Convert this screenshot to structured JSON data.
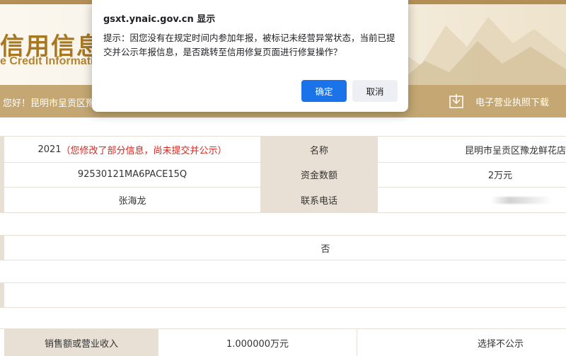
{
  "header": {
    "title_cn": "信用信息公",
    "title_en": "e Credit Informatio"
  },
  "nav": {
    "greeting": "您好！昆明市呈贡区豫",
    "download_label": "电子营业执照下载"
  },
  "table": {
    "row1": {
      "year": "2021",
      "note": "（您修改了部分信息，尚未提交并公示）",
      "label": "名称",
      "value": "昆明市呈贡区豫龙鲜花店"
    },
    "row2": {
      "value_left": "92530121MA6PACE15Q",
      "label": "资金数额",
      "value": "2万元"
    },
    "row3": {
      "value_left": "张海龙",
      "label": "联系电话"
    },
    "row5": {
      "value": "否"
    },
    "last": {
      "label": "销售额或营业收入",
      "value": "1.000000万元",
      "right": "选择不公示"
    }
  },
  "dialog": {
    "title": "gsxt.ynaic.gov.cn 显示",
    "message": "提示：因您没有在规定时间内参加年报，被标记未经营异常状态，当前已提交并公示年报信息，是否跳转至信用修复页面进行修复操作？",
    "ok_label": "确定",
    "cancel_label": "取消"
  },
  "colors": {
    "accent_gold": "#c4a772",
    "label_bg": "#e8e0d4",
    "primary_button": "#1a73e8",
    "warning_text": "#d7261d"
  }
}
